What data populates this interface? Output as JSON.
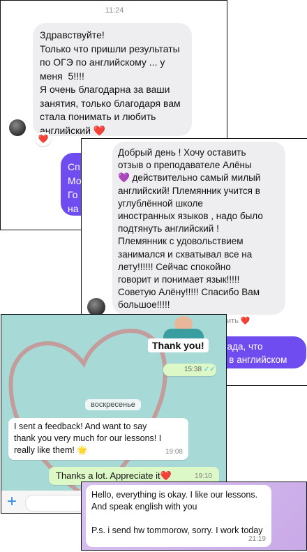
{
  "card1": {
    "time": "11:24",
    "incoming": "Здравствуйте!\nТолько что пришли результаты\nпо ОГЭ по английскому ... у\nменя  5!!!!\nЯ очень благодарна за ваши\nзанятия, только благодаря вам\nстала понимать и любить\nанглийский ❤️",
    "reaction": "❤️",
    "outgoing_partial": [
      "Сп",
      "Мо",
      "Го",
      "на"
    ]
  },
  "card2": {
    "incoming": "Добрый день ! Хочу оставить\nотзыв о преподавателе Алёны\n💜 действительно самый милый\nанглийский! Племянник учится в\nуглублённой школе\nиностранных языков , надо было\nподтянуть английский !\nПлемянник с удовольствием\nзанимался и схватывал все на\nлету!!!!!! Сейчас спокойно\nговорит и понимает язык!!!!!\nСоветую Алёну!!!!! Спасибо Вам\nбольшое!!!!!",
    "footer_partial": "авить ❤️",
    "outgoing_partial": "Рада, что\nи в английском"
  },
  "card3": {
    "sticker_text": "Thank you!",
    "sticker_time": "15:38",
    "day_label": "воскресенье",
    "msg_in": "I sent a feedback! And want to say\nthank you very much for our lessons! I\nreally like them! 🌟",
    "msg_in_time": "19:08",
    "msg_out": "Thanks a lot. Appreciate it❤️",
    "msg_out_time": "19:10",
    "plus_icon": "+",
    "accent": "#2f8ae0"
  },
  "card4": {
    "msg": "Hello, everything is okay. I like our lessons.\nAnd speak english with you\n\nP.s. i send hw tommorow, sorry. I work today",
    "time": "21:19"
  }
}
